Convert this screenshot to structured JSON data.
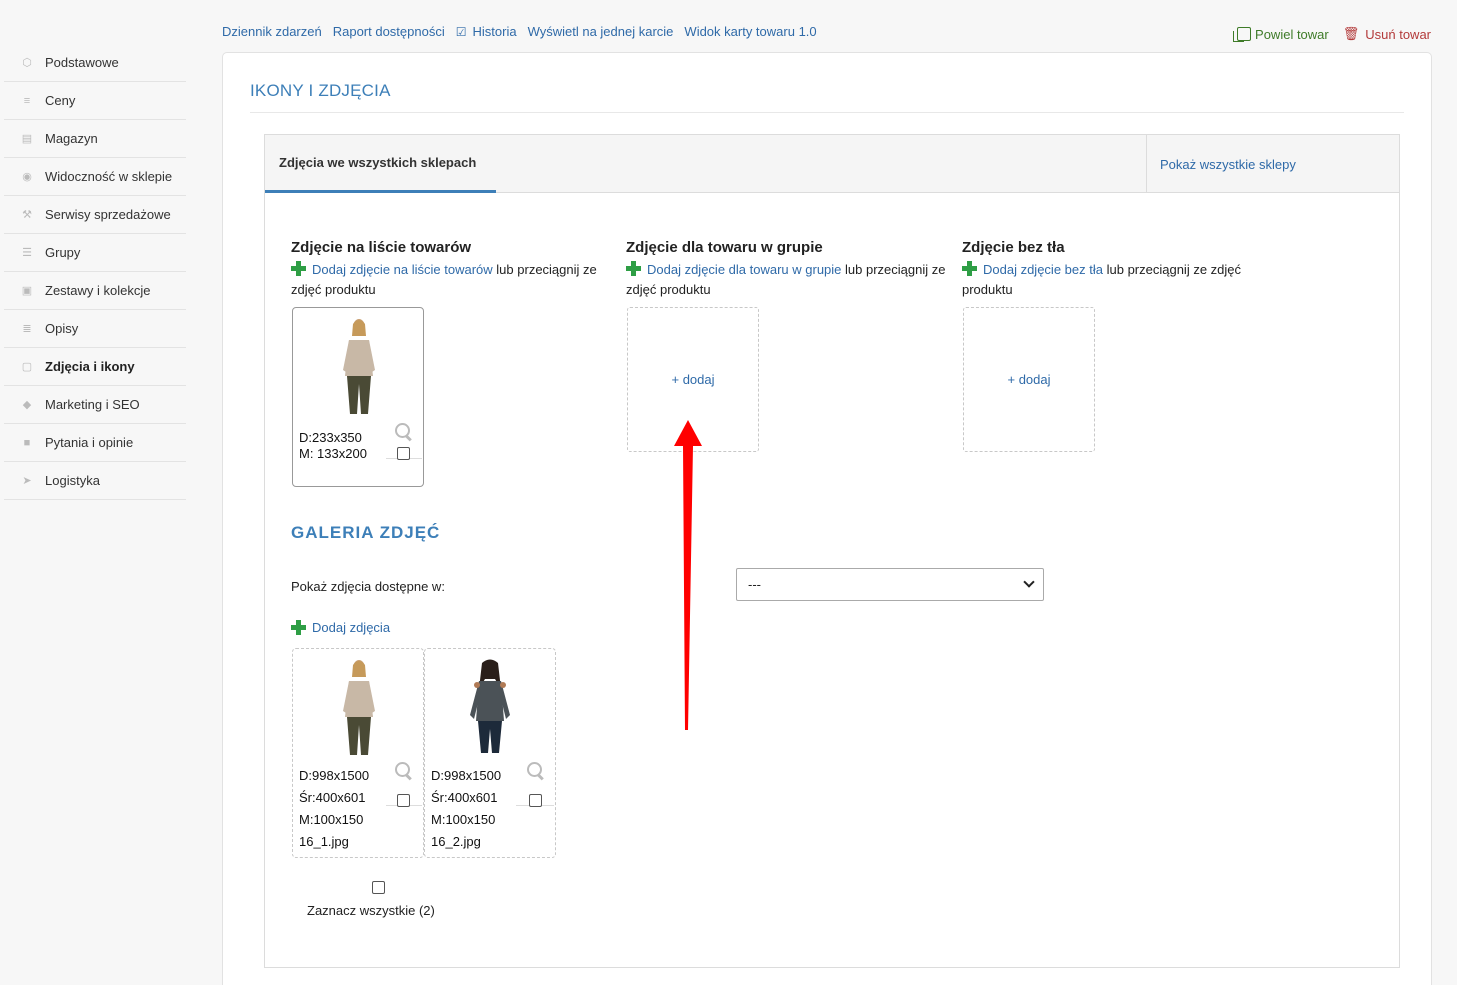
{
  "top_links": [
    "Dziennik zdarzeń",
    "Raport dostępności",
    "Historia",
    "Wyświetl na jednej karcie",
    "Widok karty towaru 1.0"
  ],
  "actions": {
    "duplicate": "Powiel towar",
    "delete": "Usuń towar"
  },
  "sidebar": {
    "items": [
      {
        "label": "Podstawowe",
        "icon": "cube-icon"
      },
      {
        "label": "Ceny",
        "icon": "coins-icon"
      },
      {
        "label": "Magazyn",
        "icon": "box-icon"
      },
      {
        "label": "Widoczność w sklepie",
        "icon": "eye-icon"
      },
      {
        "label": "Serwisy sprzedażowe",
        "icon": "gavel-icon"
      },
      {
        "label": "Grupy",
        "icon": "layers-icon"
      },
      {
        "label": "Zestawy i kolekcje",
        "icon": "collection-icon"
      },
      {
        "label": "Opisy",
        "icon": "lines-icon"
      },
      {
        "label": "Zdjęcia i ikony",
        "icon": "camera-icon"
      },
      {
        "label": "Marketing i SEO",
        "icon": "tag-icon"
      },
      {
        "label": "Pytania i opinie",
        "icon": "chat-icon"
      },
      {
        "label": "Logistyka",
        "icon": "plane-icon"
      }
    ],
    "active_index": 8
  },
  "panel": {
    "title": "IKONY I ZDJĘCIA",
    "tab_active": "Zdjęcia we wszystkich sklepach",
    "tab_right": "Pokaż wszystkie sklepy"
  },
  "columns": {
    "list": {
      "title": "Zdjęcie na liście towarów",
      "add_link": "Dodaj zdjęcie",
      "target_link": "na liście towarów",
      "tail": "lub przeciągnij ze zdjęć produktu",
      "thumb": {
        "d": "D:233x350",
        "m": "M: 133x200"
      }
    },
    "group": {
      "title": "Zdjęcie dla towaru w grupie",
      "add_link": "Dodaj zdjęcie",
      "target_link": "dla towaru w grupie",
      "tail": "lub przeciągnij ze zdjęć produktu",
      "add_label": "+ dodaj"
    },
    "nobg": {
      "title": "Zdjęcie bez tła",
      "add_link": "Dodaj zdjęcie",
      "target_link": "bez tła",
      "tail": "lub przeciągnij ze zdjęć produktu",
      "add_label": "+ dodaj"
    }
  },
  "gallery": {
    "title": "GALERIA ZDJĘĆ",
    "show_label": "Pokaż zdjęcia dostępne w:",
    "select_value": "---",
    "add_photos": "Dodaj zdjęcia",
    "photos": [
      {
        "d": "D:998x1500",
        "sr": "Śr:400x601",
        "m": "M:100x150",
        "file": "16_1.jpg"
      },
      {
        "d": "D:998x1500",
        "sr": "Śr:400x601",
        "m": "M:100x150",
        "file": "16_2.jpg"
      }
    ],
    "select_all": "Zaznacz wszystkie (2)"
  },
  "colors": {
    "accent": "#3d7fb8",
    "link": "#2f6aa8",
    "plus": "#2e9e45",
    "duplicate": "#3e7b28",
    "delete": "#b33a3a",
    "arrow": "#ff0000"
  }
}
